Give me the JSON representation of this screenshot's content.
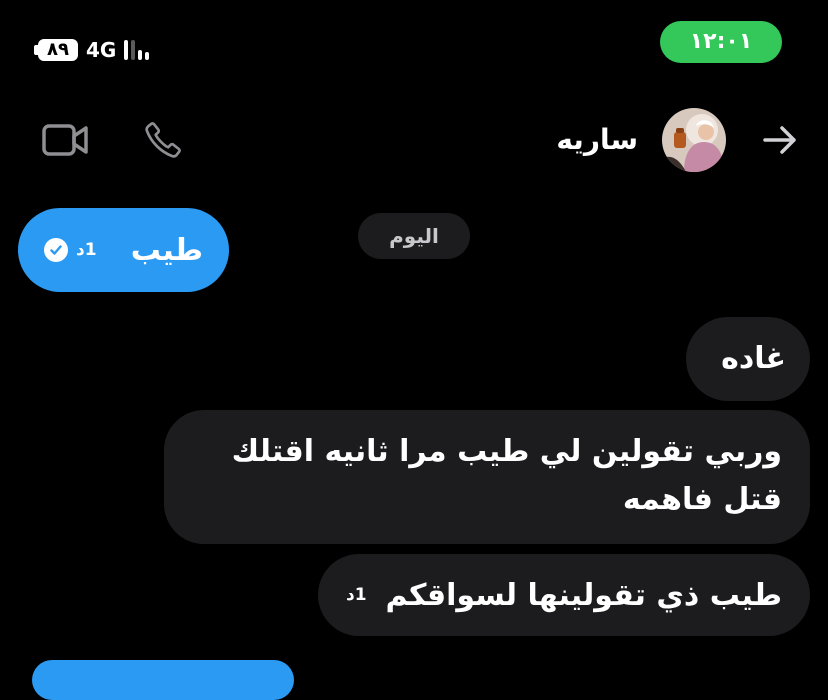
{
  "status_bar": {
    "battery": "٨٩",
    "network": "4G",
    "time": "١٢:٠١",
    "time_pill_color": "#34c759"
  },
  "header": {
    "contact_name": "ساريه",
    "icons": [
      "video-camera-icon",
      "phone-icon",
      "back-arrow-icon"
    ]
  },
  "date_separator": "اليوم",
  "messages": [
    {
      "direction": "outgoing",
      "text": "طيب",
      "meta": "1د",
      "seen": true
    },
    {
      "direction": "incoming",
      "text": "غاده"
    },
    {
      "direction": "incoming",
      "text": "وربي تقولين لي طيب مرا ثانيه اقتلك قتل فاهمه"
    },
    {
      "direction": "incoming",
      "text": "طيب ذي تقولينها لسواقكم",
      "meta": "1د"
    }
  ],
  "colors": {
    "background": "#000000",
    "outgoing_bubble": "#2b9af3",
    "incoming_bubble": "#1c1c1e"
  }
}
